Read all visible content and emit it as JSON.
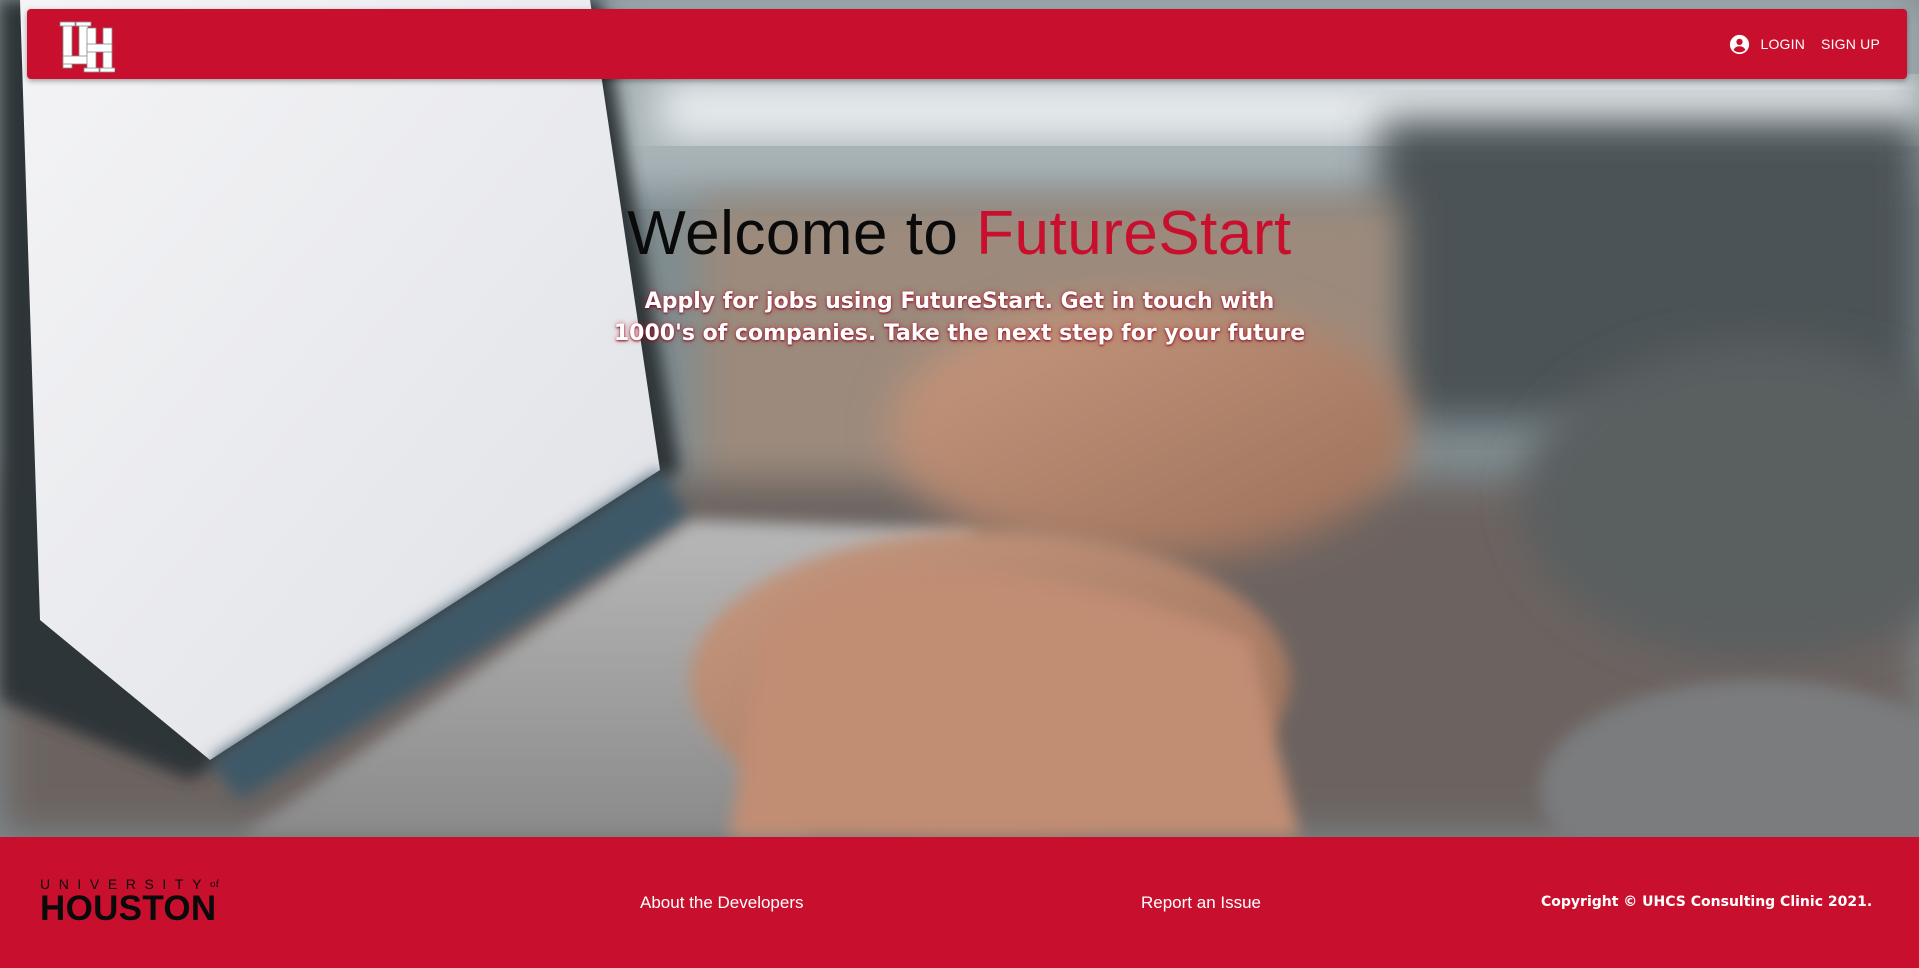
{
  "nav": {
    "logo_text": "UH",
    "login_label": "LOGIN",
    "signup_label": "SIGN UP"
  },
  "hero": {
    "title_prefix": "Welcome to ",
    "title_accent": "FutureStart",
    "subtitle": "Apply for jobs using FutureStart. Get in touch with 1000's of companies. Take the next step for your future"
  },
  "footer": {
    "brand_line1": "UNIVERSITY",
    "brand_of": "of",
    "brand_line2": "HOUSTON",
    "about_label": "About the Developers",
    "report_label": "Report an Issue",
    "copyright": "Copyright © UHCS Consulting Clinic 2021."
  },
  "colors": {
    "brand_red": "#c8102e",
    "text_dark": "#0a0a0a",
    "text_light": "#ffffff"
  },
  "icons": {
    "account": "account-circle-icon",
    "logo": "uh-interlocking-logo"
  }
}
